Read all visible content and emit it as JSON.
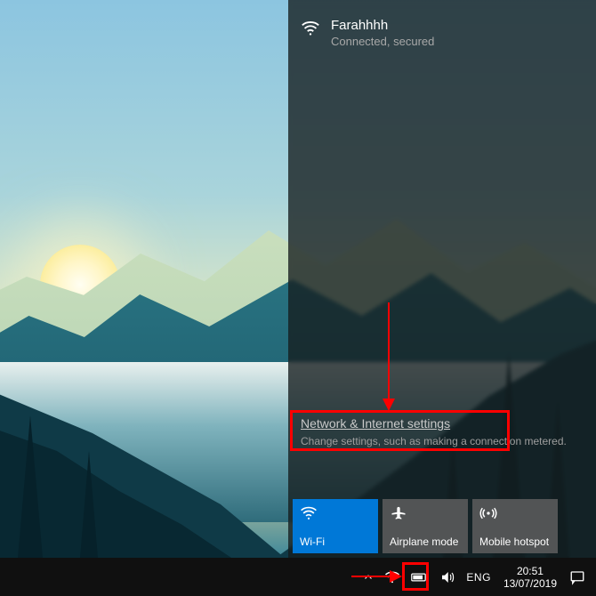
{
  "network": {
    "current": {
      "name": "Farahhhh",
      "status": "Connected, secured"
    },
    "settings": {
      "link_label": "Network & Internet settings",
      "description": "Change settings, such as making a connection metered."
    },
    "tiles": [
      {
        "id": "wifi",
        "label": "Wi-Fi",
        "active": true,
        "icon": "wifi-icon"
      },
      {
        "id": "airplane",
        "label": "Airplane mode",
        "active": false,
        "icon": "airplane-icon"
      },
      {
        "id": "hotspot",
        "label": "Mobile hotspot",
        "active": false,
        "icon": "hotspot-icon"
      }
    ]
  },
  "taskbar": {
    "language": "ENG",
    "time": "20:51",
    "date": "13/07/2019"
  },
  "icons": {
    "chevron_up": "chevron-up-icon",
    "wifi": "wifi-icon",
    "battery": "battery-icon",
    "volume": "volume-icon",
    "action_center": "action-center-icon"
  }
}
